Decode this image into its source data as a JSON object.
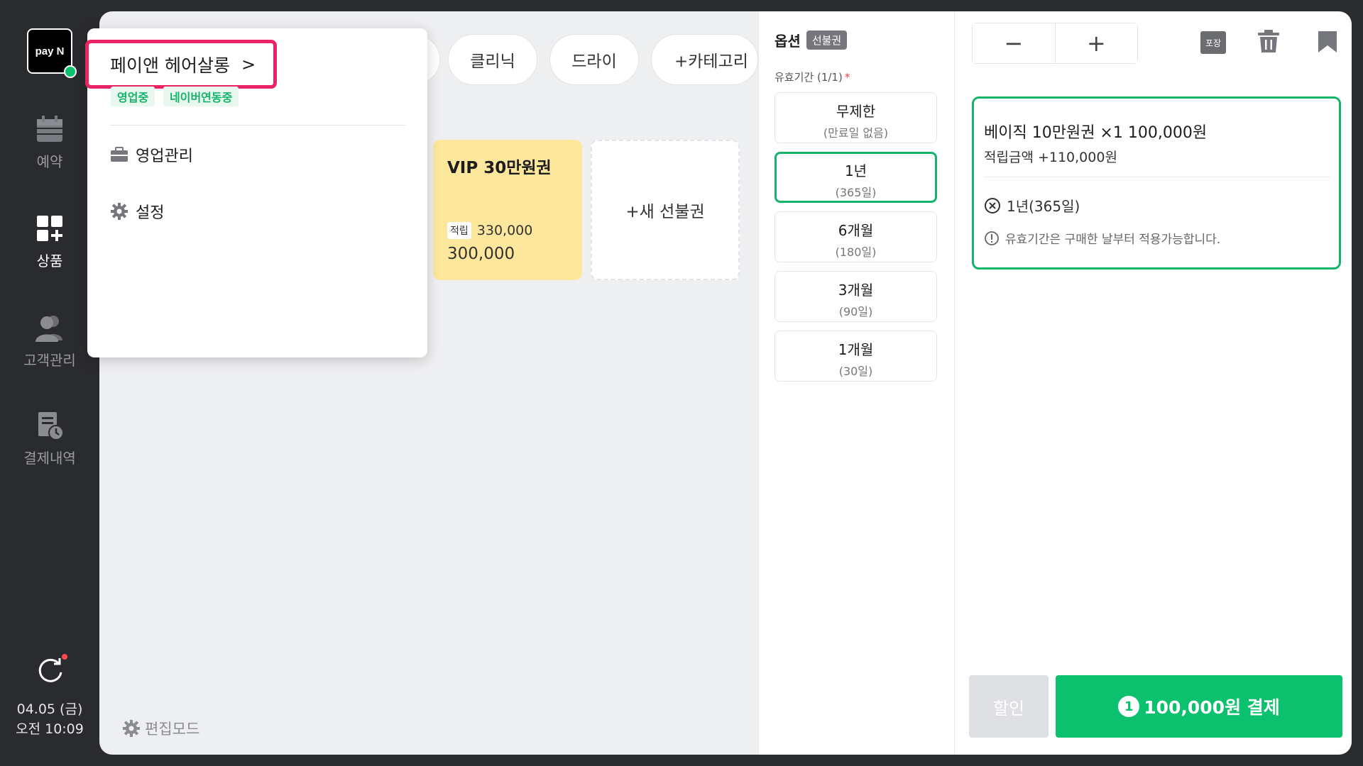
{
  "sidebar": {
    "logo_text": "pay N",
    "items": [
      {
        "label": "예약",
        "icon": "calendar-icon"
      },
      {
        "label": "상품",
        "icon": "products-grid-icon"
      },
      {
        "label": "고객관리",
        "icon": "customers-icon"
      },
      {
        "label": "결제내역",
        "icon": "payment-history-icon"
      }
    ],
    "date": "04.05 (금)",
    "time": "오전 10:09"
  },
  "categories": [
    "클리닉",
    "드라이",
    "+카테고리"
  ],
  "products": [
    {
      "name": "VIP 30만원권",
      "accum_tag": "적립",
      "accum_value": "330,000",
      "price": "300,000"
    }
  ],
  "new_prepaid_label": "+새 선불권",
  "edit_mode_label": "편집모드",
  "dropdown": {
    "store_name": "페이앤 헤어살롱",
    "tags": [
      "영업중",
      "네이버연동중"
    ],
    "menu": [
      {
        "label": "영업관리",
        "icon": "briefcase-icon"
      },
      {
        "label": "설정",
        "icon": "gear-icon"
      }
    ]
  },
  "options": {
    "title": "옵션",
    "badge": "선불권",
    "validity_label": "유효기간 (1/1)",
    "required_mark": "*",
    "choices": [
      {
        "title": "무제한",
        "sub": "(만료일 없음)",
        "selected": false
      },
      {
        "title": "1년",
        "sub": "(365일)",
        "selected": true
      },
      {
        "title": "6개월",
        "sub": "(180일)",
        "selected": false
      },
      {
        "title": "3개월",
        "sub": "(90일)",
        "selected": false
      },
      {
        "title": "1개월",
        "sub": "(30일)",
        "selected": false
      }
    ]
  },
  "cart": {
    "minus": "−",
    "plus": "+",
    "pack_label": "포장",
    "item_line": "베이직 10만원권 ×1  100,000원",
    "accum_line": "적립금액 +110,000원",
    "validity_line": "1년(365일)",
    "notice": "유효기간은 구매한 날부터 적용가능합니다.",
    "discount_label": "할인",
    "pay_count": "1",
    "pay_label": "100,000원 결제"
  },
  "colors": {
    "accent": "#0bc16e",
    "highlight": "#ea2364",
    "sidebar": "#2a2b2e",
    "vip_card": "#fde79c"
  }
}
